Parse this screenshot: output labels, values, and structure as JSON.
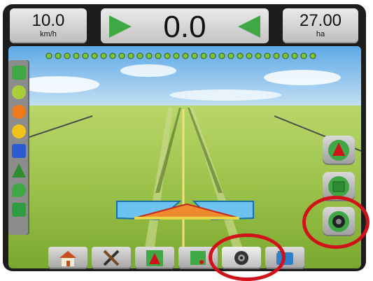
{
  "speed": {
    "value": "10.0",
    "unit": "km/h"
  },
  "cross_track": {
    "value": "0.0"
  },
  "area": {
    "value": "27.00",
    "unit": "ha"
  },
  "colors": {
    "accent_green": "#3fa844",
    "highlight_red": "#d0121b",
    "bar_bg": "#8c8c8c"
  },
  "left_toolbar": {
    "icons": [
      "map-grid-icon",
      "boundary-icon",
      "warning-orange-icon",
      "warning-yellow-icon",
      "nudge-magnet-icon",
      "guideline-marker-icon",
      "liquid-drop-icon",
      "lock-icon"
    ]
  },
  "right_toolbar": {
    "icons": [
      "perspective-view-icon",
      "map-view-icon",
      "camera-view-icon"
    ]
  },
  "bottom_toolbar": {
    "tabs": [
      "home-icon",
      "tools-icon",
      "vehicle-view-icon",
      "map-icon",
      "camera-icon",
      "guidance-box-icon"
    ],
    "active": "camera-icon"
  }
}
